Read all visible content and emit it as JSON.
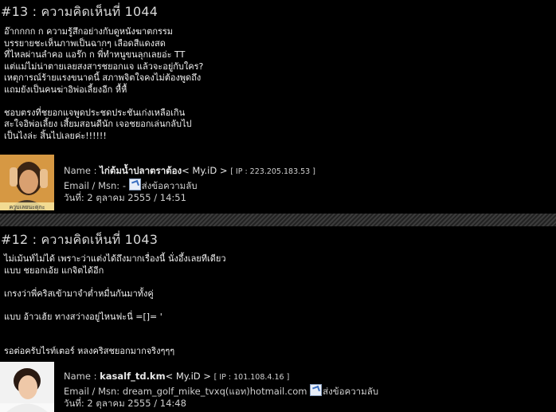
{
  "comments": [
    {
      "title": "#13 : ความคิดเห็นที่ 1044",
      "body": [
        "อ๊ากกกก ก ความรู้สึกอย่างกับดูหนังฆาตกรรม",
        "บรรยายชะเห็นภาพเป็นฉากๆ เลือดสีแดงสด",
        "ที่ไหลผ่านลำคอ แอร๊ก ก พี่ทำหนูขนลุกเลยอ่ะ TT",
        "แต่แม่ไม่น่าตายเลยสงสารชยอกแจ แล้วจะอยู่กับใคร?",
        "เหตุการณ์ร้ายแรงขนาดนี้ สภาพจิตใจคงไม่ต้องพูดถึง",
        "แถมยังเป็นคนฆ่าอิพ่อเลี้ยงอีก หื้หื้",
        "",
        "ชอบตรงที่ชยอกแจพูดประชดประชันเก่งเหลือเกิน",
        "สะใจอิพ่อเลี้ยง เสี้ยมสอนดีนัก เจอชยอกเล่นกลับไป",
        "เป็นไงล่ะ สิ้นไปเลยค่ะ!!!!!!"
      ],
      "name_label": "Name : ",
      "name": "ไก่ต้มน้ำปลาตราต้อง",
      "myid": "< My.iD >",
      "ip": "[ IP : 223.205.183.53 ]",
      "email_label": "Email / Msn: ",
      "email": "-",
      "send_msg": "ส่งข้อความลับ",
      "date": "วันที่: 2 ตุลาคม 2555 / 14:51"
    },
    {
      "title": "#12 : ความคิดเห็นที่ 1043",
      "body": [
        "ไม่เม้นท์ไม่ได้ เพราะว่าแต่งได้ถึงมากเรื่องนี้ นั่งอึ้งเลยทีเดียว",
        "แบบ ชยอกเอ้ย แกจิตได้อีก",
        "",
        "เกรงว่าพี่คริสเข้ามาจำต่ำหมื่นกันมาทั้งคู่",
        "",
        "แบบ อ้าวเฮ้ย ทางสว่างอยู่ไหนฟะนี่ =[]= '",
        "",
        "",
        "รอต่อครับไรท์เตอร์ หลงคริสชยอกมากจริงๆๆๆ"
      ],
      "name_label": "Name : ",
      "name": "kasalf_td.km",
      "myid": "< My.iD >",
      "ip": "[ IP : 101.108.4.16 ]",
      "email_label": "Email / Msn: ",
      "email": "dream_golf_mike_tvxq(แอท)hotmail.com",
      "send_msg": "ส่งข้อความลับ",
      "date": "วันที่: 2 ตุลาคม 2555 / 14:48"
    }
  ],
  "avatar_caption": "ควูบเลยนะตุกะ"
}
